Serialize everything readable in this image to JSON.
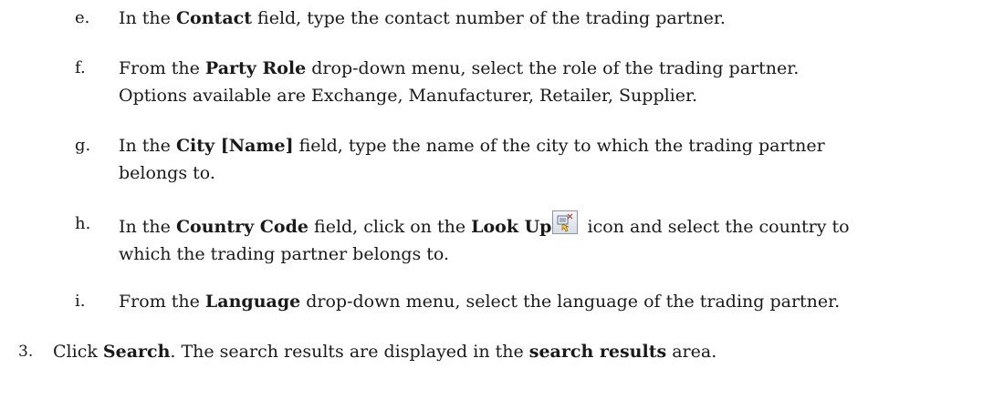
{
  "steps": {
    "e": {
      "marker": "e.",
      "t1": "In the ",
      "b1": "Contact",
      "t2": " field, type the contact number of the trading partner."
    },
    "f": {
      "marker": "f.",
      "t1": "From the ",
      "b1": "Party Role",
      "t2": " drop-down menu, select the role of the trading partner.",
      "line2": "Options available are Exchange, Manufacturer, Retailer, Supplier."
    },
    "g": {
      "marker": "g.",
      "t1": "In the ",
      "b1": "City [Name]",
      "t2": " field, type the name of the city to which the trading partner",
      "line2": "belongs to."
    },
    "h": {
      "marker": "h.",
      "t1": "In the ",
      "b1": "Country Code",
      "t2": " field, click on the ",
      "b2": "Look Up",
      "t3": " icon and select the country to",
      "line2": "which the trading partner belongs to.",
      "icon": "look-up-icon"
    },
    "i": {
      "marker": "i.",
      "t1": "From the ",
      "b1": "Language",
      "t2": " drop-down menu, select the language of the trading partner."
    },
    "three": {
      "marker": "3.",
      "t1": "Click ",
      "b1": "Search",
      "t2": ". The search results are displayed in the ",
      "b2": "search results",
      "t3": " area."
    }
  }
}
